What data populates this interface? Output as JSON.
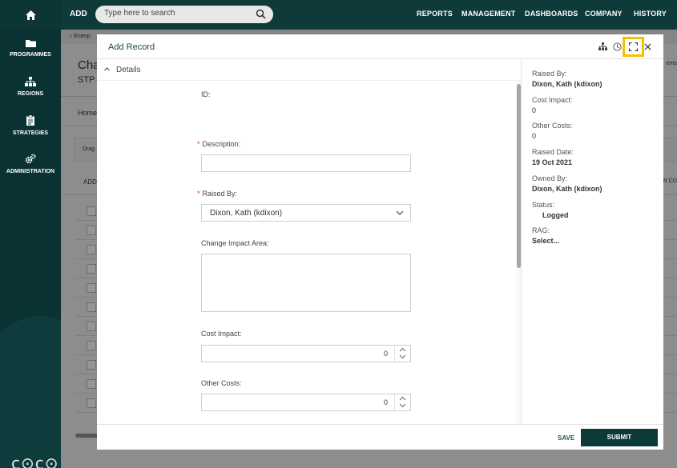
{
  "topbar": {
    "add_label": "ADD",
    "search_placeholder": "Type here to search",
    "nav": [
      "REPORTS",
      "MANAGEMENT",
      "DASHBOARDS",
      "COMPANY",
      "HISTORY"
    ]
  },
  "sidebar": {
    "items": [
      {
        "label": "PROGRAMMES",
        "icon": "folder-icon"
      },
      {
        "label": "REGIONS",
        "icon": "hierarchy-icon"
      },
      {
        "label": "STRATEGIES",
        "icon": "clipboard-icon"
      },
      {
        "label": "ADMINISTRATION",
        "icon": "gears-icon"
      }
    ],
    "logo": "c⊙c⊙"
  },
  "background": {
    "breadcrumb": "Enterp",
    "title": "Cha",
    "subtitle": "STP",
    "tab": "Home",
    "drag": "Drag",
    "add": "ADD",
    "right_top": "ents",
    "right_col": "W CO"
  },
  "modal": {
    "title": "Add Record",
    "section": "Details",
    "fields": {
      "id_label": "ID:",
      "description_label": "Description:",
      "raised_by_label": "Raised By:",
      "raised_by_value": "Dixon, Kath (kdixon)",
      "change_impact_label": "Change Impact Area:",
      "cost_impact_label": "Cost Impact:",
      "cost_impact_value": "0",
      "other_costs_label": "Other Costs:",
      "other_costs_value": "0"
    },
    "summary": [
      {
        "key": "Raised By:",
        "value": "Dixon, Kath (kdixon)"
      },
      {
        "key": "Cost Impact:",
        "value": "0"
      },
      {
        "key": "Other Costs:",
        "value": "0"
      },
      {
        "key": "Raised Date:",
        "value": "19 Oct 2021"
      },
      {
        "key": "Owned By:",
        "value": "Dixon, Kath (kdixon)"
      },
      {
        "key": "Status:",
        "value": "Logged"
      },
      {
        "key": "RAG:",
        "value": "Select..."
      }
    ],
    "footer": {
      "save_label": "SAVE",
      "submit_label": "SUBMIT"
    }
  },
  "colors": {
    "brand_dark": "#0f3a3a",
    "highlight": "#f2c200",
    "required": "#d0342c"
  }
}
